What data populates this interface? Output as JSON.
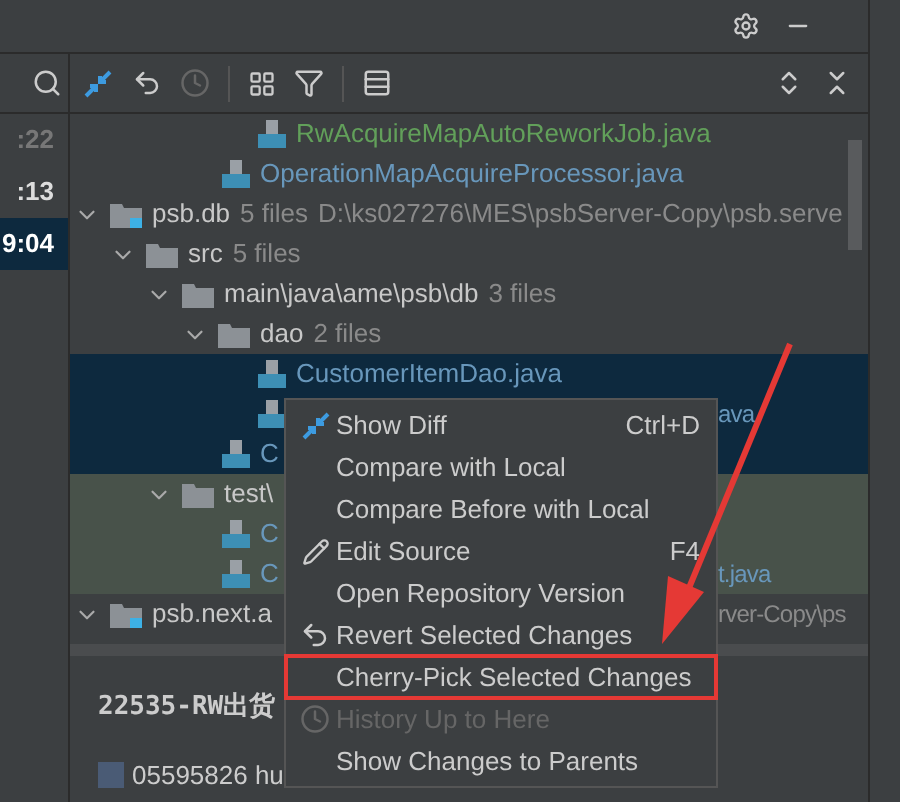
{
  "left_strip": {
    "times": [
      {
        "text": ":22",
        "selected": false,
        "dim": true
      },
      {
        "text": ":13",
        "selected": false,
        "dim": false
      },
      {
        "text": "9:04",
        "selected": true,
        "dim": false
      }
    ]
  },
  "tree": {
    "hidden_parent_children": [
      {
        "kind": "file",
        "name": "RwAcquireMapAutoReworkJob.java",
        "color": "#62a05a",
        "selected": false
      }
    ],
    "continued": [
      {
        "kind": "file",
        "name": "OperationMapAcquireProcessor.java",
        "color": "#6897bb",
        "selected": false
      }
    ],
    "nodes": [
      {
        "kind": "module",
        "name": "psb.db",
        "count": "5 files",
        "path": "D:\\ks027276\\MES\\psbServer-Copy\\psb.serve",
        "selected": false,
        "expanded": true,
        "children": [
          {
            "kind": "folder",
            "name": "src",
            "count": "5 files",
            "selected": false,
            "expanded": true,
            "children": [
              {
                "kind": "folder",
                "name": "main\\java\\ame\\psb\\db",
                "count": "3 files",
                "selected": false,
                "expanded": true,
                "children": [
                  {
                    "kind": "folder",
                    "name": "dao",
                    "count": "2 files",
                    "selected": false,
                    "expanded": true,
                    "children": [
                      {
                        "kind": "file",
                        "name": "CustomerItemDao.java",
                        "color": "#6897bb",
                        "selected": true
                      },
                      {
                        "kind": "file",
                        "tail": "ava",
                        "color": "#6897bb",
                        "selected": true
                      }
                    ]
                  },
                  {
                    "kind": "file",
                    "name": "C",
                    "color": "#6897bb",
                    "selected": true
                  }
                ]
              },
              {
                "kind": "folder",
                "name": "test\\",
                "selected": false,
                "highlighted": true,
                "expanded": true,
                "children": [
                  {
                    "kind": "file",
                    "name": "C",
                    "color": "#6897bb",
                    "selected": false,
                    "highlighted": true
                  },
                  {
                    "kind": "file",
                    "name": "C",
                    "tail": "t.java",
                    "color": "#6897bb",
                    "selected": false,
                    "highlighted": true
                  }
                ]
              }
            ]
          }
        ]
      },
      {
        "kind": "module",
        "name": "psb.next.a",
        "tail": "rver-Copy\\ps",
        "selected": false,
        "expanded": true
      }
    ]
  },
  "menu": {
    "items": [
      {
        "kind": "diff",
        "label": "Show Diff",
        "shortcut": "Ctrl+D",
        "disabled": false,
        "highlighted": false
      },
      {
        "kind": "plain",
        "label": "Compare with Local",
        "disabled": false,
        "highlighted": false
      },
      {
        "kind": "plain",
        "label": "Compare Before with Local",
        "disabled": false,
        "highlighted": false
      },
      {
        "kind": "edit",
        "label": "Edit Source",
        "shortcut": "F4",
        "disabled": false,
        "highlighted": false
      },
      {
        "kind": "plain",
        "label": "Open Repository Version",
        "disabled": false,
        "highlighted": false
      },
      {
        "kind": "revert",
        "label": "Revert Selected Changes",
        "disabled": false,
        "highlighted": false
      },
      {
        "kind": "plain",
        "label": "Cherry-Pick Selected Changes",
        "disabled": false,
        "highlighted": true
      },
      {
        "kind": "history",
        "label": "History Up to Here",
        "disabled": true,
        "highlighted": false
      },
      {
        "kind": "plain",
        "label": "Show Changes to Parents",
        "disabled": false,
        "highlighted": false
      }
    ]
  },
  "details": {
    "title": "22535-RW出货",
    "author": "05595826 hu"
  }
}
